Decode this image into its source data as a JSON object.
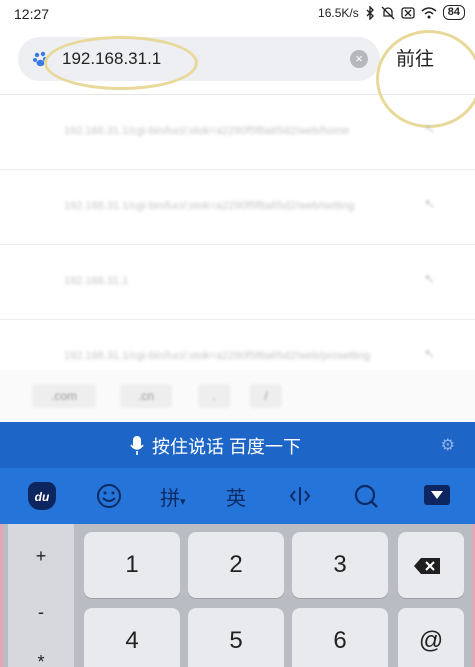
{
  "status_bar": {
    "time": "12:27",
    "network_speed": "16.5K/s",
    "battery": "84",
    "icons": [
      "bluetooth-icon",
      "mute-bell-icon",
      "sim-off-icon",
      "wifi-icon",
      "battery-icon"
    ]
  },
  "address_bar": {
    "url": "192.168.31.1",
    "site_icon": "baidu-paw-icon",
    "clear_icon": "clear-icon",
    "go_label": "前往",
    "highlight_color": "#e8d99a"
  },
  "suggestions": [
    {
      "text": "192.168.31.1/cgi-bin/luci/;stok=a2290f5f8a65d2/web/home"
    },
    {
      "text": "192.168.31.1/cgi-bin/luci/;stok=a2290f5f8a65d2/web/setting"
    },
    {
      "text": "192.168.31.1"
    },
    {
      "text": "192.168.31.1/cgi-bin/luci/;stok=a2290f5f8a65d2/web/prosetting"
    }
  ],
  "quick_inputs": [
    ".com",
    ".cn",
    ".",
    "/"
  ],
  "voice_bar": {
    "label": "按住说话 百度一下",
    "mic_icon": "mic-icon",
    "settings_icon": "settings-icon",
    "color": "#1d66c7"
  },
  "ime_toolbar": {
    "logo_text": "du",
    "pinyin_label": "拼",
    "english_label": "英",
    "items": [
      "emoji-icon",
      "cursor-icon",
      "search-icon",
      "hide-keyboard-icon"
    ],
    "color": "#2574d9"
  },
  "keypad": {
    "symbols": [
      "+",
      "-",
      "*"
    ],
    "row1": [
      "1",
      "2",
      "3"
    ],
    "row2": [
      "4",
      "5",
      "6",
      "@"
    ],
    "backspace_icon": "backspace-icon"
  }
}
